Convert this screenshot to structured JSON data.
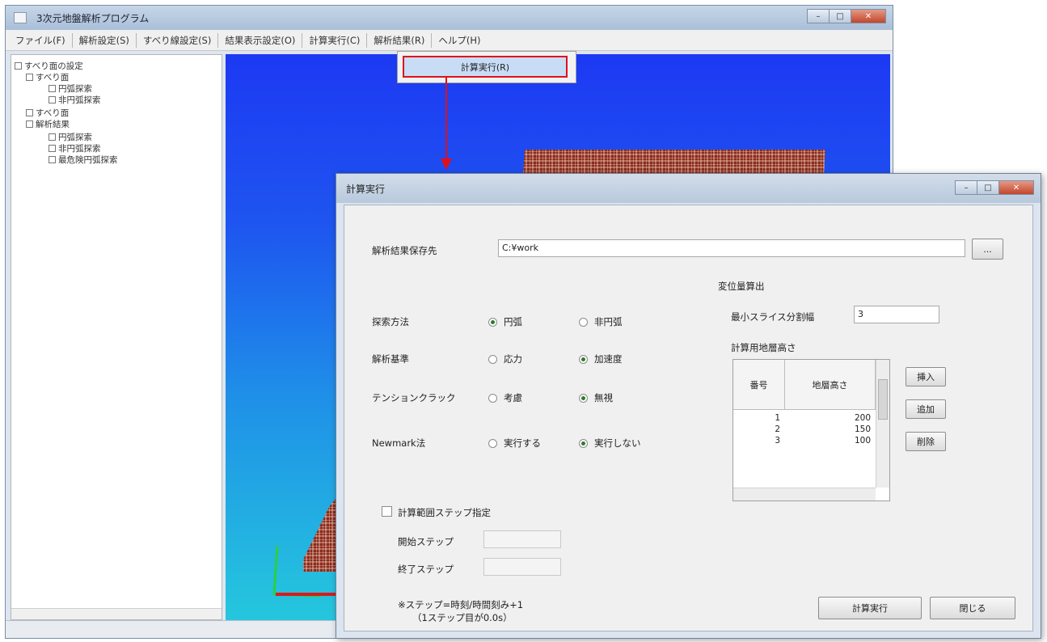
{
  "main_window": {
    "title": "3次元地盤解析プログラム",
    "menu": [
      "ファイル(F)",
      "解析設定(S)",
      "すべり線設定(S)",
      "結果表示設定(O)",
      "計算実行(C)",
      "解析結果(R)",
      "ヘルプ(H)"
    ],
    "dropdown_item": "計算実行(R)",
    "tree": [
      "すべり面の設定",
      "すべり面",
      "円弧探索",
      "非円弧探索",
      "すべり面",
      "解析結果",
      "円弧探索",
      "非円弧探索",
      "最危険円弧探索"
    ]
  },
  "dialog": {
    "title": "計算実行",
    "save_dest_label": "解析結果保存先",
    "save_dest_value": "C:¥work",
    "browse_label": "...",
    "search_method_label": "探索方法",
    "search_opt1": "円弧",
    "search_opt2": "非円弧",
    "criteria_label": "解析基準",
    "criteria_opt1": "応力",
    "criteria_opt2": "加速度",
    "tension_label": "テンションクラック",
    "tension_opt1": "考慮",
    "tension_opt2": "無視",
    "newmark_label": "Newmark法",
    "newmark_opt1": "実行する",
    "newmark_opt2": "実行しない",
    "disp_header": "変位量算出",
    "min_slice_label": "最小スライス分割幅",
    "min_slice_value": "3",
    "layer_height_label": "計算用地層高さ",
    "grid_col1": "番号",
    "grid_col2": "地層高さ",
    "grid_rows": [
      {
        "no": "1",
        "height": "200"
      },
      {
        "no": "2",
        "height": "150"
      },
      {
        "no": "3",
        "height": "100"
      }
    ],
    "insert_label": "挿入",
    "add_label": "追加",
    "delete_label": "削除",
    "step_range_label": "計算範囲ステップ指定",
    "start_step_label": "開始ステップ",
    "end_step_label": "終了ステップ",
    "note_line1": "※ステップ=時刻/時間刻み+1",
    "note_line2": "（1ステップ目が0.0s）",
    "run_label": "計算実行",
    "close_label": "閉じる"
  },
  "colors": {
    "highlight_border": "#e0101a",
    "arrow": "#e0101a",
    "model_brick": "#8b2a1a",
    "sky_top": "#1d39f3",
    "sky_bottom": "#25c7dd"
  }
}
